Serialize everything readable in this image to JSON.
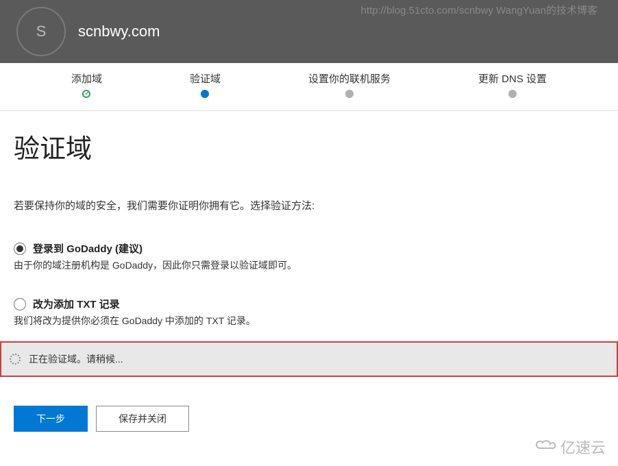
{
  "watermark": "http://blog.51cto.com/scnbwy WangYuan的技术博客",
  "header": {
    "avatar_letter": "S",
    "domain": "scnbwy.com"
  },
  "stepper": {
    "steps": [
      {
        "label": "添加域",
        "state": "done"
      },
      {
        "label": "验证域",
        "state": "active"
      },
      {
        "label": "设置你的联机服务",
        "state": "pending"
      },
      {
        "label": "更新 DNS 设置",
        "state": "pending"
      }
    ]
  },
  "page": {
    "title": "验证域",
    "instruction": "若要保持你的域的安全，我们需要你证明你拥有它。选择验证方法:"
  },
  "options": {
    "godaddy": {
      "label": "登录到 GoDaddy (建议)",
      "desc": "由于你的域注册机构是 GoDaddy，因此你只需登录以验证域即可。",
      "selected": true
    },
    "txt": {
      "label": "改为添加 TXT 记录",
      "desc": "我们将改为提供你必须在 GoDaddy 中添加的 TXT 记录。",
      "selected": false
    }
  },
  "status": {
    "text": "正在验证域。请稍候..."
  },
  "buttons": {
    "next": "下一步",
    "save_close": "保存并关闭"
  },
  "footer_logo": "亿速云"
}
